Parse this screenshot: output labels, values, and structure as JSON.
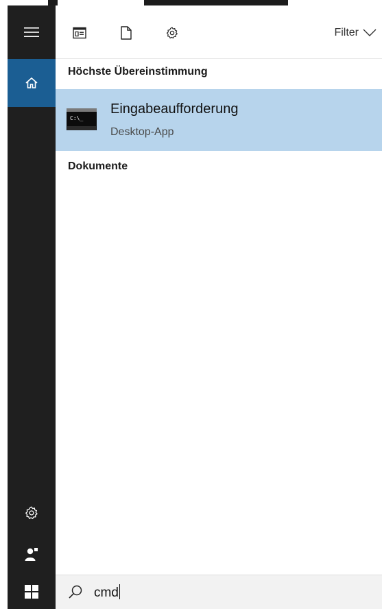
{
  "colors": {
    "rail_bg": "#1f1f1f",
    "home_accent": "#1b5e93",
    "selected_result_bg": "#b7d4ec",
    "search_bg": "#f2f2f2"
  },
  "rail": {
    "menu_icon": "hamburger-icon",
    "home_icon": "home-icon",
    "settings_icon": "gear-icon",
    "user_icon": "user-icon",
    "start_icon": "windows-logo-icon"
  },
  "toolbar": {
    "apps_icon": "apps-filter-icon",
    "documents_icon": "document-icon",
    "settings_icon": "gear-icon",
    "filter_label": "Filter"
  },
  "results": {
    "best_match_title": "Höchste Übereinstimmung",
    "best_match": {
      "title": "Eingabeaufforderung",
      "subtitle": "Desktop-App",
      "icon": "command-prompt-icon",
      "icon_text": "C:\\_"
    },
    "documents_title": "Dokumente"
  },
  "search": {
    "value": "cmd",
    "icon": "search-icon"
  }
}
